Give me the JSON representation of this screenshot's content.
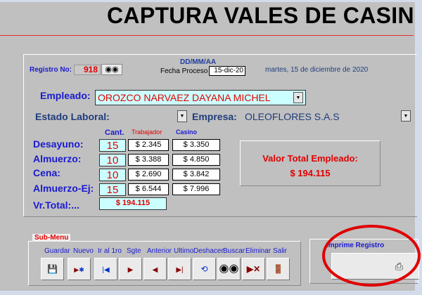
{
  "title": "CAPTURA VALES DE CASINO",
  "registro": {
    "label": "Registro No:",
    "value": "918"
  },
  "fecha": {
    "format": "DD/MM/AA",
    "label": "Fecha Proceso",
    "value": "15-dic-20",
    "long": "martes, 15 de diciembre de 2020"
  },
  "empleado": {
    "label": "Empleado:",
    "value": "OROZCO NARVAEZ DAYANA MICHEL"
  },
  "estado": {
    "label": "Estado Laboral:",
    "value": ""
  },
  "empresa": {
    "label": "Empresa:",
    "value": "OLEOFLORES S.A.S"
  },
  "headers": {
    "cant": "Cant.",
    "trabajador": "Trabajador",
    "casino": "Casino"
  },
  "rows": [
    {
      "label": "Desayuno:",
      "cant": "15",
      "trabajador": "$ 2.345",
      "casino": "$ 3.350"
    },
    {
      "label": "Almuerzo:",
      "cant": "10",
      "trabajador": "$ 3.388",
      "casino": "$ 4.850"
    },
    {
      "label": "Cena:",
      "cant": "10",
      "trabajador": "$ 2.690",
      "casino": "$ 3.842"
    },
    {
      "label": "Almuerzo-Ej:",
      "cant": "15",
      "trabajador": "$ 6.544",
      "casino": "$ 7.996"
    }
  ],
  "vrtotal": {
    "label": "Vr.Total:...",
    "value": "$ 194.115"
  },
  "valor_total": {
    "label": "Valor Total Empleado:",
    "value": "$ 194.115"
  },
  "submenu": {
    "label": "Sub-Menu",
    "buttons": [
      {
        "label": "Guardar",
        "icon": "save-icon"
      },
      {
        "label": "Nuevo",
        "icon": "new-record-icon"
      },
      {
        "label": "Ir al 1ro",
        "icon": "first-record-icon"
      },
      {
        "label": "Sgte",
        "icon": "next-icon"
      },
      {
        "label": "Anterior",
        "icon": "previous-icon"
      },
      {
        "label": "Ultimo",
        "icon": "last-record-icon"
      },
      {
        "label": "Deshacer",
        "icon": "undo-icon"
      },
      {
        "label": "Buscar",
        "icon": "binoculars-icon"
      },
      {
        "label": "Eliminar",
        "icon": "delete-icon"
      },
      {
        "label": "Salir",
        "icon": "exit-icon"
      }
    ]
  },
  "imprime": {
    "label": "Imprime Registro"
  },
  "colors": {
    "bg": "#c0c0c0",
    "accent_red": "#e00000",
    "label_blue": "#1a1ad0",
    "field_cyan": "#ccffff"
  }
}
